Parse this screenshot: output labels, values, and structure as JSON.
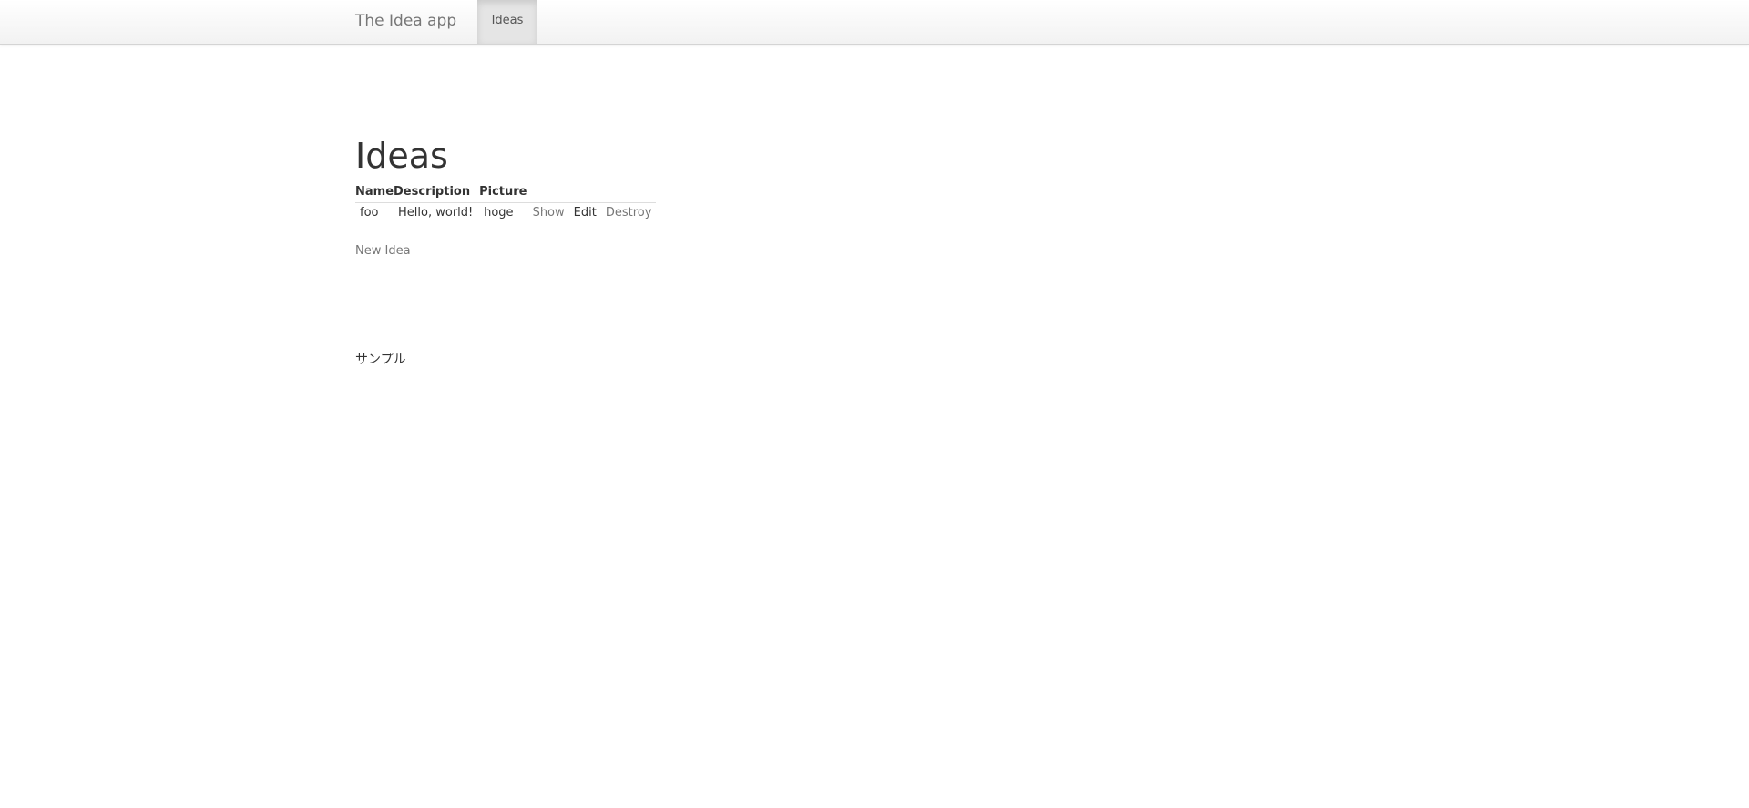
{
  "navbar": {
    "brand": "The Idea app",
    "items": [
      {
        "label": "Ideas",
        "active": true
      }
    ]
  },
  "page": {
    "title": "Ideas",
    "new_link": "New Idea",
    "footer_text": "サンプル"
  },
  "table": {
    "headers": [
      "Name",
      "Description",
      "Picture"
    ],
    "rows": [
      {
        "name": "foo",
        "description": "Hello, world!",
        "picture": "hoge",
        "actions": {
          "show": "Show",
          "edit": "Edit",
          "destroy": "Destroy"
        }
      }
    ]
  },
  "colors": {
    "navbar_bg": "#f2f2f2",
    "active_nav_bg": "#e5e5e5",
    "link": "#777777",
    "text": "#333333"
  }
}
